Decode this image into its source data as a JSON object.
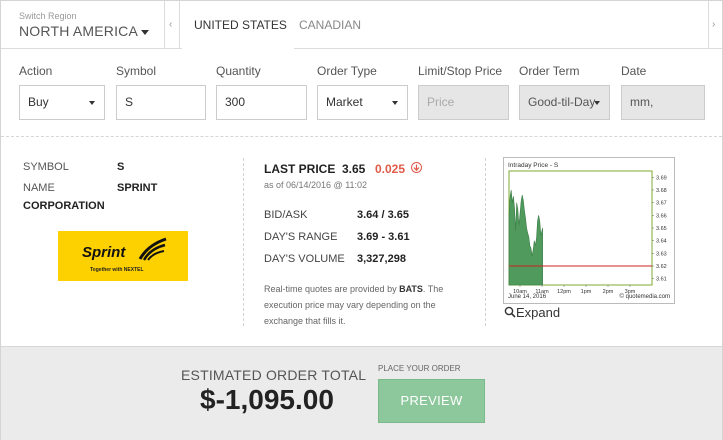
{
  "header": {
    "region_label": "Switch Region",
    "region_value": "NORTH AMERICA",
    "tabs": [
      {
        "label": "UNITED STATES",
        "active": true
      },
      {
        "label": "CANADIAN",
        "active": false
      }
    ]
  },
  "form": {
    "action": {
      "label": "Action",
      "value": "Buy"
    },
    "symbol": {
      "label": "Symbol",
      "value": "S"
    },
    "quantity": {
      "label": "Quantity",
      "value": "300"
    },
    "order_type": {
      "label": "Order Type",
      "value": "Market"
    },
    "limit_stop": {
      "label": "Limit/Stop Price",
      "placeholder": "Price"
    },
    "order_term": {
      "label": "Order Term",
      "value": "Good-til-Day"
    },
    "date": {
      "label": "Date",
      "value": "mm,"
    }
  },
  "quote": {
    "symbol_label": "SYMBOL",
    "symbol_value": "S",
    "name_label": "NAME",
    "name_value_1": "SPRINT",
    "name_value_2": "CORPORATION",
    "logo_text": "Sprint",
    "logo_sub": "Together with NEXTEL",
    "last_price_label": "LAST PRICE",
    "last_price": "3.65",
    "change": "0.025",
    "as_of": "as of 06/14/2016 @ 11:02",
    "bid_ask_label": "BID/ASK",
    "bid_ask": "3.64 / 3.65",
    "days_range_label": "DAY'S RANGE",
    "days_range": "3.69 - 3.61",
    "days_volume_label": "DAY'S VOLUME",
    "days_volume": "3,327,298",
    "note_pre": "Real-time quotes are provided by ",
    "note_bold": "BATS",
    "note_post": ". The execution price may vary depending on the exchange that fills it."
  },
  "chart": {
    "title": "Intraday Price - S",
    "date_label": "June 14, 2016",
    "source": "© quotemedia.com",
    "expand_label": "Expand",
    "colors": {
      "area": "#4f9a5c",
      "ref_line": "#cc2222",
      "frame": "#7ea832"
    }
  },
  "chart_data": {
    "type": "area",
    "title": "Intraday Price - S",
    "x_ticks": [
      "10am",
      "11am",
      "12pm",
      "1pm",
      "2pm",
      "3pm"
    ],
    "y_ticks": [
      3.69,
      3.68,
      3.67,
      3.66,
      3.65,
      3.64,
      3.63,
      3.62,
      3.61
    ],
    "ylim": [
      3.605,
      3.695
    ],
    "xlim": [
      9.5,
      16.0
    ],
    "reference_line": 3.62,
    "series": [
      {
        "x": [
          9.5,
          9.55,
          9.6,
          9.65,
          9.7,
          9.75,
          9.8,
          9.85,
          9.9,
          9.95,
          10.0,
          10.05,
          10.1,
          10.15,
          10.2,
          10.25,
          10.3,
          10.35,
          10.4,
          10.45,
          10.5,
          10.55,
          10.6,
          10.65,
          10.7,
          10.75,
          10.8,
          10.85,
          10.9,
          10.95,
          11.0,
          11.03
        ],
        "y": [
          3.66,
          3.675,
          3.68,
          3.67,
          3.675,
          3.666,
          3.648,
          3.67,
          3.665,
          3.652,
          3.661,
          3.671,
          3.676,
          3.672,
          3.664,
          3.658,
          3.65,
          3.646,
          3.643,
          3.636,
          3.634,
          3.628,
          3.633,
          3.64,
          3.636,
          3.642,
          3.656,
          3.66,
          3.655,
          3.644,
          3.648,
          3.65
        ]
      }
    ]
  },
  "footer": {
    "est_label": "ESTIMATED ORDER TOTAL",
    "est_value": "$-1,095.00",
    "place_label": "PLACE YOUR ORDER",
    "preview_label": "PREVIEW"
  }
}
